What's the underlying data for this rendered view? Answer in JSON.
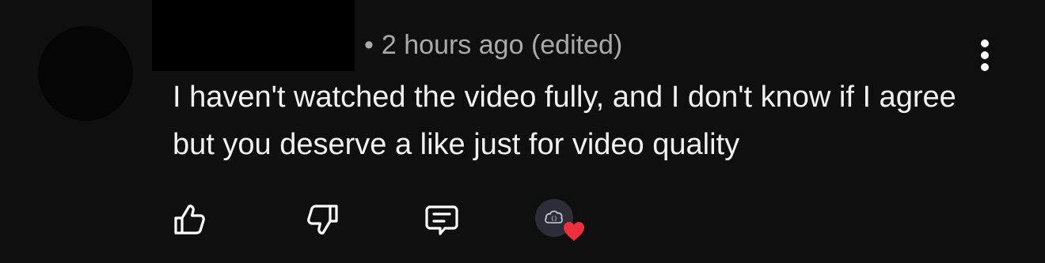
{
  "comment": {
    "author_redacted": true,
    "bullet": "•",
    "timestamp": "2 hours ago",
    "edited_label": "(edited)",
    "text": "I haven't watched the video fully, and I don't know if I agree but you deserve a like just for video quality"
  },
  "actions": {
    "like_icon": "thumbs-up-icon",
    "dislike_icon": "thumbs-down-icon",
    "reply_icon": "reply-comment-icon",
    "creator_heart_icon": "heart-icon",
    "menu_icon": "more-vertical-icon"
  },
  "colors": {
    "background": "#0f0f0f",
    "text": "#f1f1f1",
    "meta_text": "#aaaaaa",
    "heart": "#ee2f3f",
    "creator_avatar": "#2d2d38"
  }
}
